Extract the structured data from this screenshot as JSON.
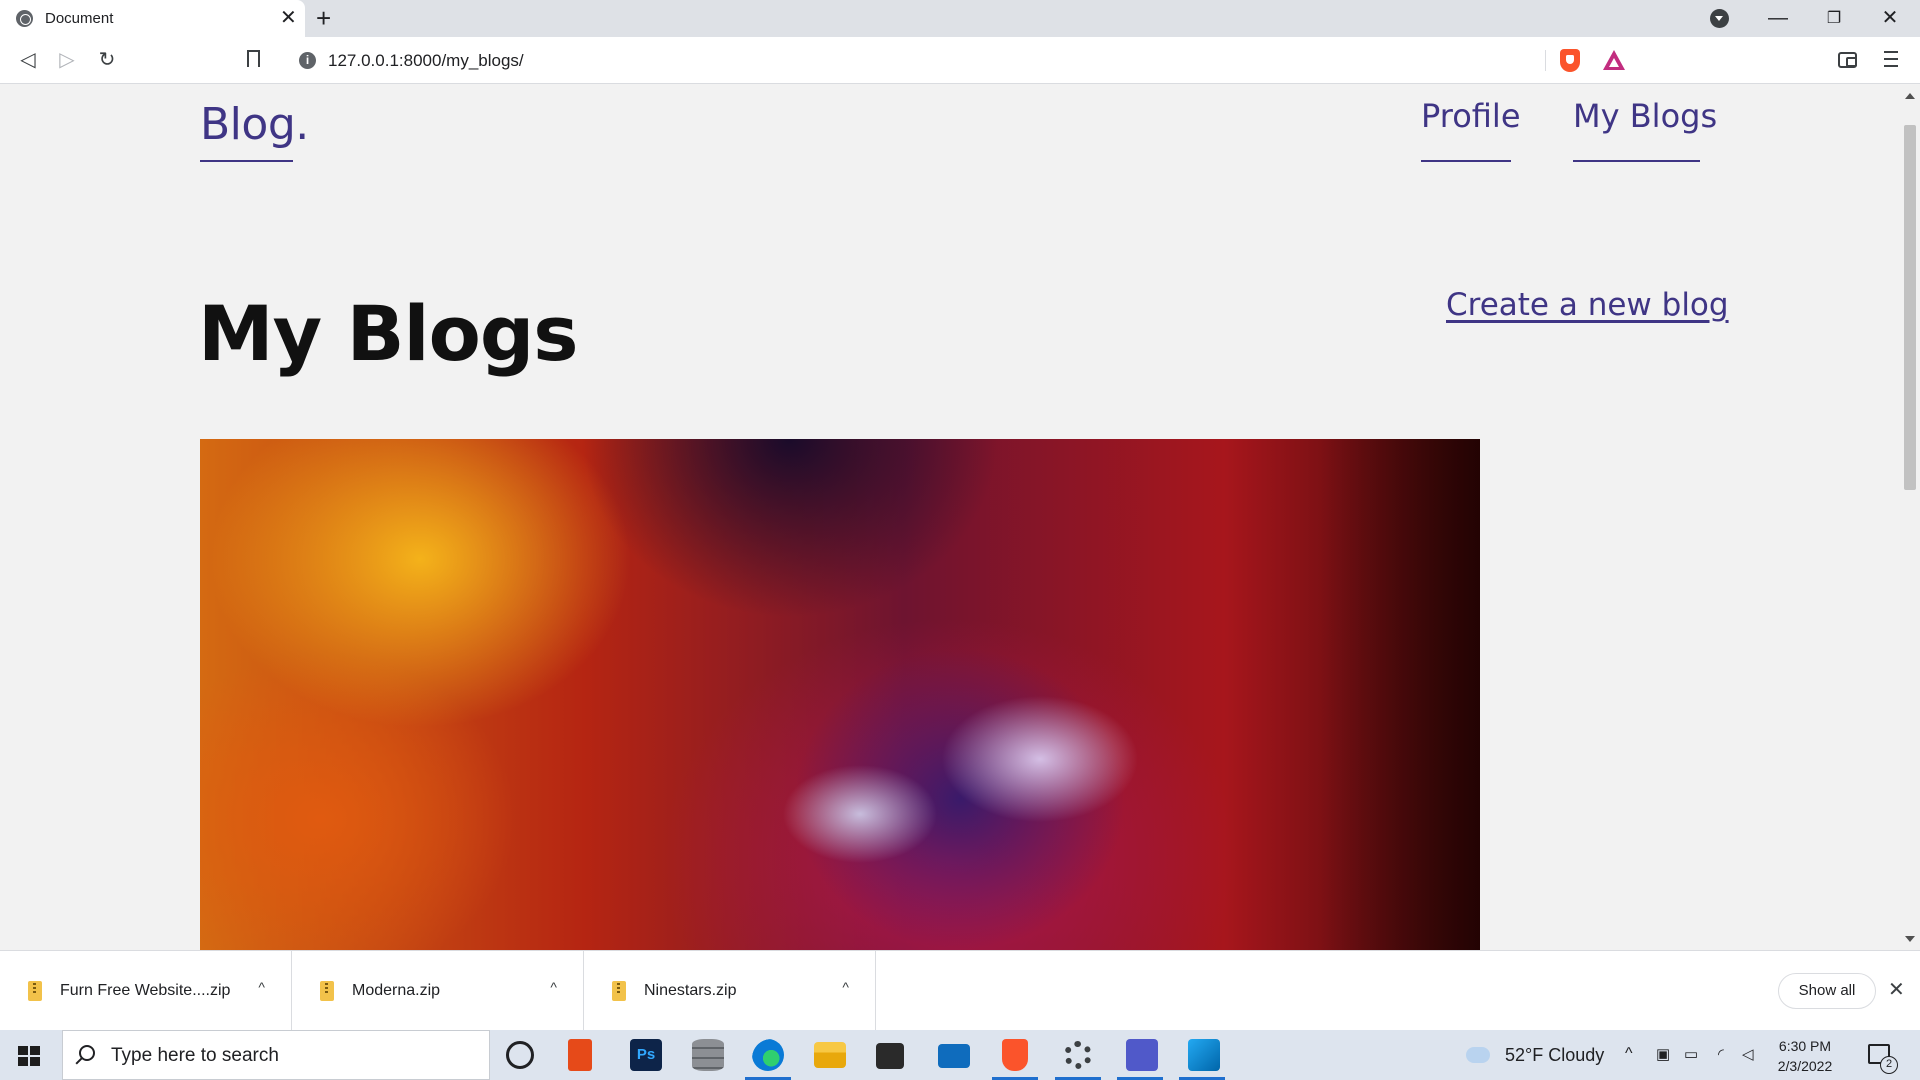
{
  "browser": {
    "tab_title": "Document",
    "tab_close": "✕",
    "new_tab": "+",
    "url": "127.0.0.1:8000/my_blogs/",
    "window": {
      "minimize": "—",
      "restore": "❐",
      "close": "✕"
    },
    "nav": {
      "back": "◁",
      "forward": "▷",
      "reload": "↻"
    }
  },
  "site": {
    "logo": "Blog.",
    "nav": [
      {
        "label": "Profile"
      },
      {
        "label": "My Blogs"
      }
    ],
    "page_title": "My Blogs",
    "create_link": "Create a new blog",
    "accent_color": "#3f3585"
  },
  "downloads": {
    "items": [
      {
        "name": "Furn Free Website....zip"
      },
      {
        "name": "Moderna.zip"
      },
      {
        "name": "Ninestars.zip"
      }
    ],
    "chevron": "^",
    "show_all": "Show all",
    "close": "✕"
  },
  "taskbar": {
    "search_placeholder": "Type here to search",
    "weather": "52°F  Cloudy",
    "time": "6:30 PM",
    "date": "2/3/2022",
    "notification_count": "2",
    "apps": [
      "cortana-icon",
      "office-icon",
      "photoshop-icon",
      "database-icon",
      "edge-icon",
      "file-explorer-icon",
      "store-icon",
      "mail-icon",
      "brave-icon",
      "settings-icon",
      "teams-icon",
      "vscode-icon"
    ]
  }
}
